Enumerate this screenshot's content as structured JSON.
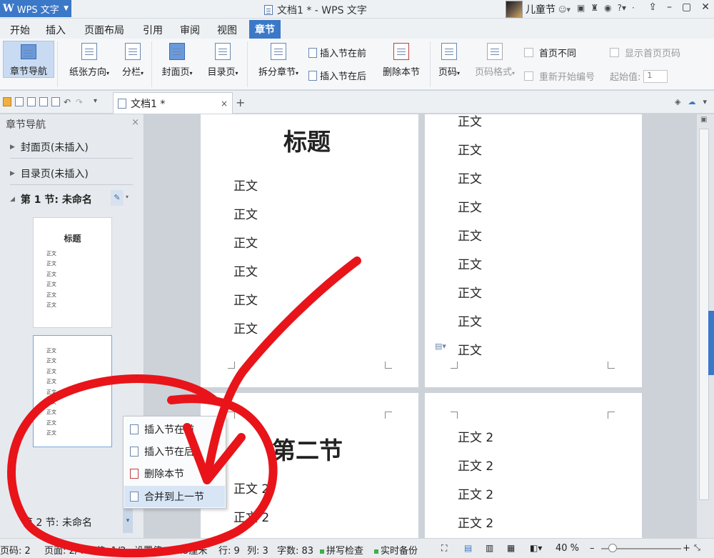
{
  "app": {
    "name": "WPS 文字",
    "window_title": "文档1 * - WPS 文字",
    "user": "儿童节"
  },
  "menu": [
    "开始",
    "插入",
    "页面布局",
    "引用",
    "审阅",
    "视图",
    "章节"
  ],
  "ribbon": {
    "chapter_nav": "章节导航",
    "paper_dir": "纸张方向",
    "columns": "分栏",
    "cover": "封面页",
    "toc": "目录页",
    "split": "拆分章节",
    "insert_before": "插入节在前",
    "insert_after": "插入节在后",
    "delete_section": "删除本节",
    "page_num": "页码",
    "page_format": "页码格式",
    "first_diff": "首页不同",
    "show_first_num": "显示首页页码",
    "restart_num": "重新开始编号",
    "start_label": "起始值:",
    "start_value": "1"
  },
  "doc_tab": {
    "title": "文档1 *",
    "close": "×",
    "new": "+"
  },
  "nav": {
    "title": "章节导航",
    "close": "×",
    "cover": "封面页(未插入)",
    "toc": "目录页(未插入)",
    "section1": "第 1 节: 未命名",
    "section2": "第 2 节: 未命名",
    "thumb1_title": "标题",
    "thumb_line": "正文"
  },
  "context_menu": {
    "insert_before": "插入节在前",
    "insert_after": "插入节在后",
    "delete": "删除本节",
    "merge": "合并到上一节"
  },
  "doc": {
    "title": "标题",
    "body": "正文",
    "section2_title": "第二节",
    "body2": "正文 2"
  },
  "status": {
    "page": "页码: 2",
    "pages": "页面: 2/4",
    "section": "节: 1/2",
    "setting": "设置值: 24.5厘米",
    "row": "行: 9",
    "col": "列: 3",
    "words": "字数: 83",
    "spell": "拼写检查",
    "backup": "实时备份",
    "zoom": "40 %"
  },
  "colors": {
    "accent": "#3b78c8",
    "annotation": "#e8141a"
  }
}
